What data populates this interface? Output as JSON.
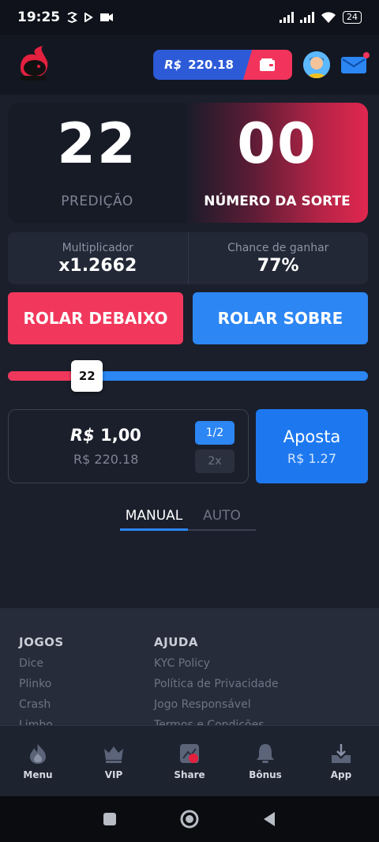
{
  "status_bar": {
    "time": "19:25",
    "battery": "24"
  },
  "header": {
    "balance_currency": "R$",
    "balance_value": "220.18",
    "colors": {
      "balance_bg": "#2d5bd8",
      "wallet_bg": "#f2335b"
    }
  },
  "game": {
    "prediction_value": "22",
    "prediction_label": "PREDIÇÃO",
    "lucky_value": "00",
    "lucky_label": "NÚMERO DA SORTE",
    "multiplier_label": "Multiplicador",
    "multiplier_value": "x1.2662",
    "chance_label": "Chance de ganhar",
    "chance_value": "77%",
    "roll_under_label": "ROLAR DEBAIXO",
    "roll_over_label": "ROLAR SOBRE",
    "slider_value": "22",
    "slider_level": 0.22
  },
  "bet": {
    "currency": "R$",
    "amount": "1,00",
    "balance": "R$ 220.18",
    "half_label": "1/2",
    "double_label": "2x",
    "button_label": "Aposta",
    "button_amount": "R$ 1.27"
  },
  "tabs": [
    {
      "label": "MANUAL",
      "active": true
    },
    {
      "label": "AUTO",
      "active": false
    }
  ],
  "footer": {
    "jogos_title": "JOGOS",
    "jogos_links": [
      "Dice",
      "Plinko",
      "Crash",
      "Limbo"
    ],
    "ajuda_title": "AJUDA",
    "ajuda_links": [
      "KYC Policy",
      "Política de Privacidade",
      "Jogo Responsável",
      "Termos e Condições"
    ]
  },
  "bottom_nav": [
    {
      "label": "Menu",
      "icon": "flame-icon"
    },
    {
      "label": "VIP",
      "icon": "crown-icon"
    },
    {
      "label": "Share",
      "icon": "share-icon"
    },
    {
      "label": "Bônus",
      "icon": "bell-icon"
    },
    {
      "label": "App",
      "icon": "download-icon"
    }
  ]
}
